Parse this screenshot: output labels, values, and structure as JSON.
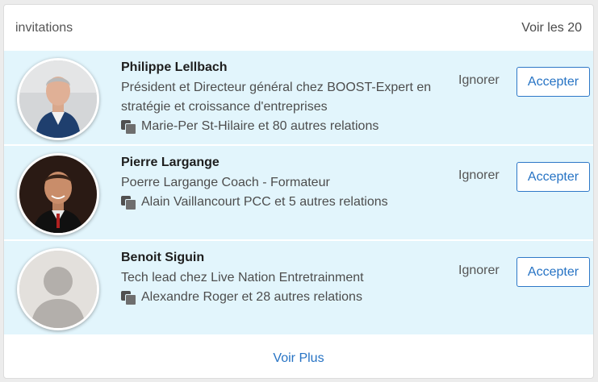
{
  "header": {
    "title": "invitations",
    "see_all": "Voir les 20"
  },
  "invitations": [
    {
      "name": "Philippe Lellbach",
      "title_line1": "Président et Directeur général chez BOOST-Expert en",
      "title_line2": "stratégie et croissance d'entreprises",
      "mutual": "Marie-Per St-Hilaire et 80 autres relations",
      "ignore_label": "Ignorer",
      "accept_label": "Accepter",
      "avatar": "photo-man-grey-hair-navy-suit"
    },
    {
      "name": "Pierre Largange",
      "title_line1": "Poerre Largange Coach - Formateur",
      "mutual": "Alain Vaillancourt PCC et 5 autres relations",
      "ignore_label": "Ignorer",
      "accept_label": "Accepter",
      "avatar": "photo-man-dark-background"
    },
    {
      "name": "Benoit Siguin",
      "title_line1": "Tech lead chez Live Nation Entretrainment",
      "mutual": "Alexandre Roger et 28 autres relations",
      "ignore_label": "Ignorer",
      "accept_label": "Accepter",
      "avatar": "default-avatar-silhouette"
    }
  ],
  "footer": {
    "more_label": "Voir Plus"
  },
  "colors": {
    "row_background": "#e2f5fc",
    "accent": "#2673c4"
  }
}
